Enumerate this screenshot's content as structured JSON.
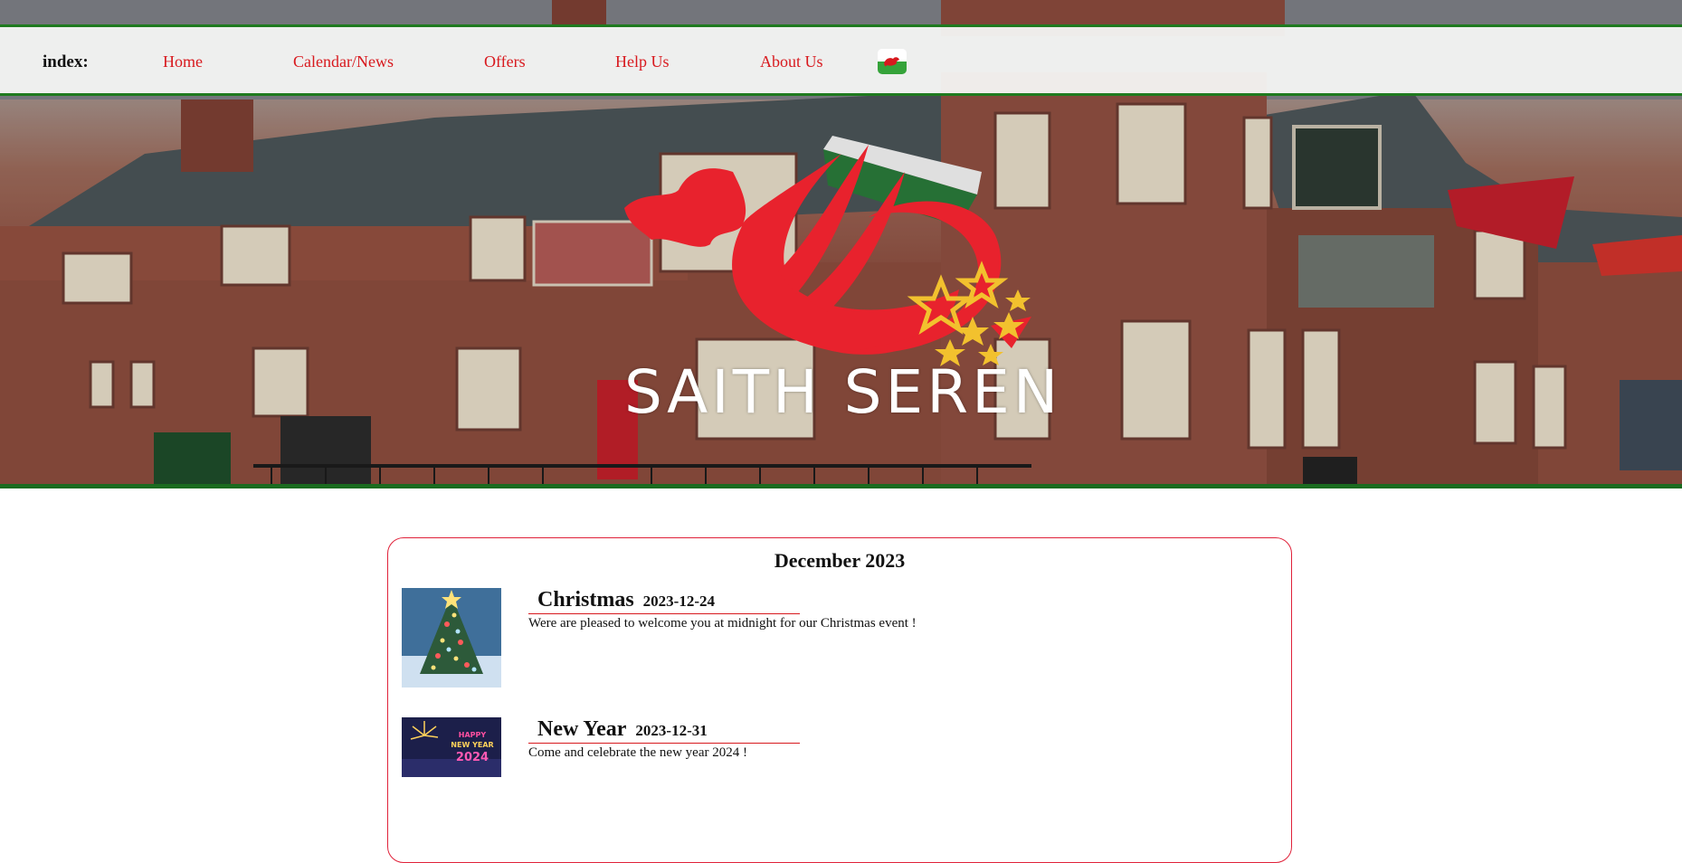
{
  "nav": {
    "index_label": "index:",
    "links": [
      "Home",
      "Calendar/News",
      "Offers",
      "Help Us",
      "About Us"
    ],
    "flag_icon": "welsh-flag-icon"
  },
  "hero": {
    "logo_text": "SAITH SEREN",
    "accent": "#e8222d",
    "star_color": "#f2c12e",
    "border_green": "#1a6b1f"
  },
  "news": {
    "month": "December 2023",
    "items": [
      {
        "title": "Christmas",
        "date": "2023-12-24",
        "description": "Were are pleased to welcome you at midnight for our Christmas event !"
      },
      {
        "title": "New Year",
        "date": "2023-12-31",
        "description": "Come and celebrate the new year 2024 !",
        "image_text": "HAPPY NEW YEAR 2024"
      }
    ],
    "border_color": "#e0223a"
  }
}
